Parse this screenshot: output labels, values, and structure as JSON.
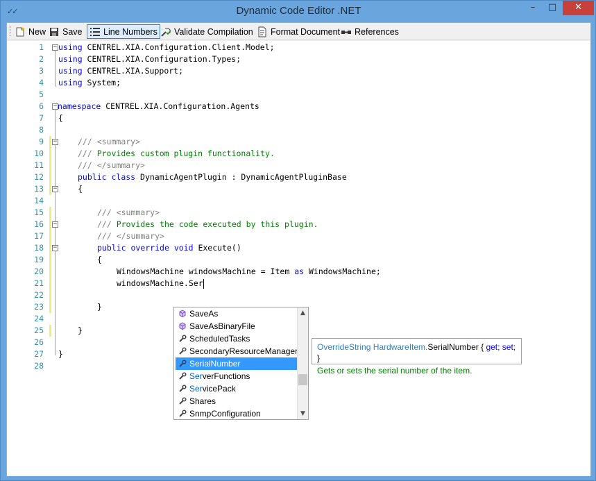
{
  "window": {
    "title": "Dynamic Code Editor .NET",
    "minimize_label": "–",
    "maximize_label": "□",
    "close_label": "✕",
    "app_icon_glyph": "✓✓"
  },
  "toolbar": {
    "new_label": "New",
    "save_label": "Save",
    "line_numbers_label": "Line Numbers",
    "validate_label": "Validate Compilation",
    "format_label": "Format Document",
    "references_label": "References"
  },
  "editor": {
    "line_numbers": [
      "1",
      "2",
      "3",
      "4",
      "5",
      "6",
      "7",
      "8",
      "9",
      "10",
      "11",
      "12",
      "13",
      "14",
      "15",
      "16",
      "17",
      "18",
      "19",
      "20",
      "21",
      "22",
      "23",
      "24",
      "25",
      "26",
      "27",
      "28"
    ],
    "code": {
      "l1": {
        "kw": "using",
        "rest": " CENTREL.XIA.Configuration.Client.Model;"
      },
      "l2": {
        "kw": "using",
        "rest": " CENTREL.XIA.Configuration.Types;"
      },
      "l3": {
        "kw": "using",
        "rest": " CENTREL.XIA.Support;"
      },
      "l4": {
        "kw": "using",
        "rest": " System;"
      },
      "l6": {
        "kw": "namespace",
        "rest": " CENTREL.XIA.Configuration.Agents"
      },
      "l7": "{",
      "l9": {
        "xd1": "/// ",
        "xd2": "<summary>"
      },
      "l10": {
        "xd1": "/// ",
        "cm": "Provides custom plugin functionality."
      },
      "l11": {
        "xd1": "/// ",
        "xd2": "</summary>"
      },
      "l12": {
        "kw1": "public",
        "kw2": "class",
        "rest": " DynamicAgentPlugin : DynamicAgentPluginBase"
      },
      "l13": "{",
      "l15": {
        "xd1": "/// ",
        "xd2": "<summary>"
      },
      "l16": {
        "xd1": "/// ",
        "cm": "Provides the code executed by this plugin."
      },
      "l17": {
        "xd1": "/// ",
        "xd2": "</summary>"
      },
      "l18": {
        "kw1": "public",
        "kw2": "override",
        "kw3": "void",
        "rest": " Execute()"
      },
      "l19": "{",
      "l20": {
        "a": "WindowsMachine windowsMachine = Item ",
        "kw": "as",
        "b": " WindowsMachine;"
      },
      "l21": "windowsMachine.Ser",
      "l23": "}",
      "l25": "}",
      "l27": "}"
    }
  },
  "completion": {
    "items": [
      {
        "label": "SaveAs",
        "icon": "method-icon",
        "match": ""
      },
      {
        "label": "SaveAsBinaryFile",
        "icon": "method-icon",
        "match": ""
      },
      {
        "label": "ScheduledTasks",
        "icon": "property-icon",
        "match": ""
      },
      {
        "label": "SecondaryResourceManager",
        "icon": "property-icon",
        "match": ""
      },
      {
        "label": "SerialNumber",
        "icon": "property-icon",
        "match": "",
        "selected": true
      },
      {
        "label": "verFunctions",
        "icon": "property-icon",
        "match": "Ser"
      },
      {
        "label": "vicePack",
        "icon": "property-icon",
        "match": "Ser"
      },
      {
        "label": "Shares",
        "icon": "property-icon",
        "match": ""
      },
      {
        "label": "SnmpConfiguration",
        "icon": "property-icon",
        "match": ""
      }
    ],
    "scroll_up": "▲",
    "scroll_down": "▼"
  },
  "tooltip": {
    "type_prefix": "OverrideString HardwareItem.",
    "member": "SerialNumber",
    "open_brace": " { ",
    "get": "get;",
    "set": "set;",
    "close_brace": " }",
    "description": "Gets or sets the serial number of the item."
  },
  "colors": {
    "title_bar": "#6aa6dd",
    "close_button": "#c7413a",
    "keyword": "#0000ff",
    "comment": "#008000",
    "line_number": "#2b91af",
    "selection": "#3399ff"
  }
}
